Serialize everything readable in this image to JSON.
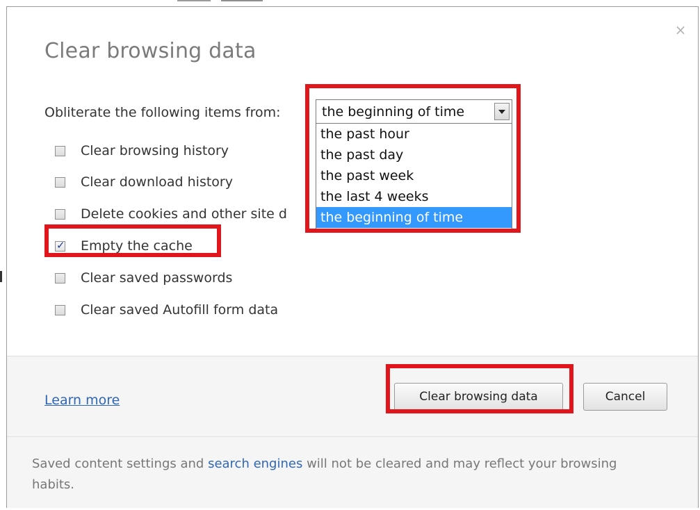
{
  "dialog": {
    "title": "Clear browsing data",
    "close_icon": "close-icon"
  },
  "time_range": {
    "label": "Obliterate the following items from:",
    "selected": "the beginning of time",
    "options": [
      "the past hour",
      "the past day",
      "the past week",
      "the last 4 weeks",
      "the beginning of time"
    ],
    "selected_index": 4,
    "expanded": true
  },
  "items": [
    {
      "label": "Clear browsing history",
      "checked": false
    },
    {
      "label": "Clear download history",
      "checked": false
    },
    {
      "label": "Delete cookies and other site d",
      "checked": false
    },
    {
      "label": "Empty the cache",
      "checked": true
    },
    {
      "label": "Clear saved passwords",
      "checked": false
    },
    {
      "label": "Clear saved Autofill form data",
      "checked": false
    }
  ],
  "footer": {
    "learn_more": "Learn more",
    "clear_button": "Clear browsing data",
    "cancel_button": "Cancel",
    "note_prefix": "Saved content settings and ",
    "note_link": "search engines",
    "note_suffix": " will not be cleared and may reflect your browsing habits."
  },
  "colors": {
    "highlight": "#e0161c",
    "selection": "#3399ff",
    "link": "#2f66b6"
  }
}
